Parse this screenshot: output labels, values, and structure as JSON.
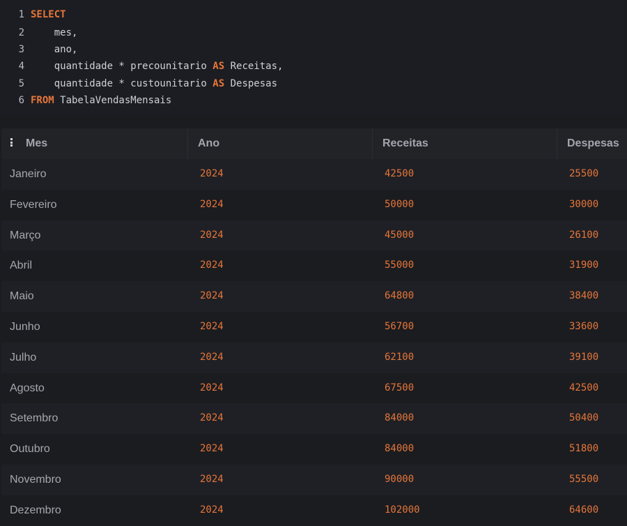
{
  "editor": {
    "lines": [
      {
        "no": "1",
        "kw": "SELECT",
        "text": ""
      },
      {
        "no": "2",
        "text": "    mes,"
      },
      {
        "no": "3",
        "text": "    ano,"
      },
      {
        "no": "4",
        "pre": "    quantidade * precounitario ",
        "kw": "AS",
        "post": " Receitas,"
      },
      {
        "no": "5",
        "pre": "    quantidade * custounitario ",
        "kw": "AS",
        "post": " Despesas"
      },
      {
        "no": "6",
        "kw": "FROM",
        "post": " TabelaVendasMensais"
      }
    ]
  },
  "table": {
    "columns": [
      "Mes",
      "Ano",
      "Receitas",
      "Despesas"
    ],
    "rows": [
      [
        "Janeiro",
        "2024",
        "42500",
        "25500"
      ],
      [
        "Fevereiro",
        "2024",
        "50000",
        "30000"
      ],
      [
        "Março",
        "2024",
        "45000",
        "26100"
      ],
      [
        "Abril",
        "2024",
        "55000",
        "31900"
      ],
      [
        "Maio",
        "2024",
        "64800",
        "38400"
      ],
      [
        "Junho",
        "2024",
        "56700",
        "33600"
      ],
      [
        "Julho",
        "2024",
        "62100",
        "39100"
      ],
      [
        "Agosto",
        "2024",
        "67500",
        "42500"
      ],
      [
        "Setembro",
        "2024",
        "84000",
        "50400"
      ],
      [
        "Outubro",
        "2024",
        "84000",
        "51800"
      ],
      [
        "Novembro",
        "2024",
        "90000",
        "55500"
      ],
      [
        "Dezembro",
        "2024",
        "102000",
        "64600"
      ]
    ]
  },
  "colors": {
    "keyword": "#e6763a",
    "number": "#e6763a",
    "text": "#a4a8ae",
    "background": "#1b1c20"
  }
}
